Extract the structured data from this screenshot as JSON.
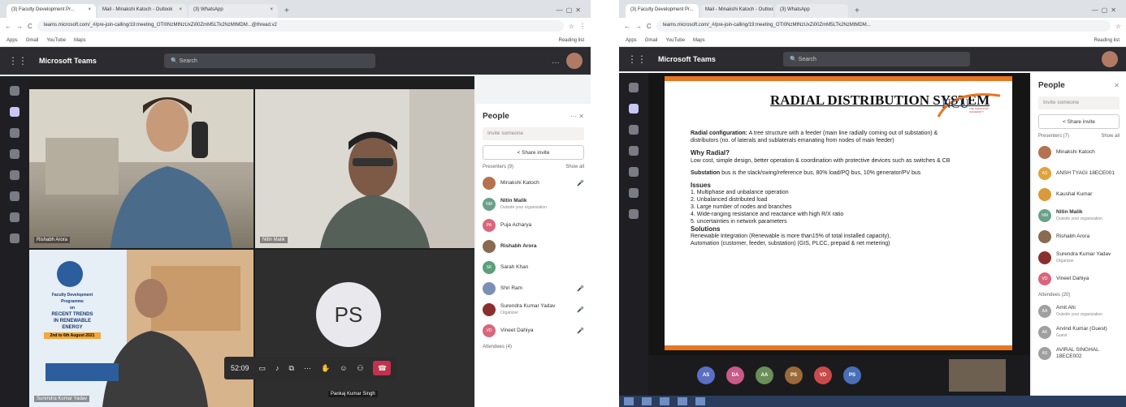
{
  "left": {
    "tabs": [
      "(3) Faculty Development Pr...",
      "Mail - Minakshi Katoch - Outlook",
      "(3) WhatsApp"
    ],
    "url": "teams.microsoft.com/_#/pre-join-calling/19:meeting_OTI0NzMtNzUxZi00ZmM5LTk2NzMtMDM...@thread.v2",
    "bookmarks": [
      "Apps",
      "Gmail",
      "YouTube",
      "Maps"
    ],
    "reading_list": "Reading list",
    "teams_title": "Microsoft Teams",
    "search_placeholder": "Search",
    "tiles": {
      "t1": "Rishabh Arora",
      "t2": "Nitin Malik",
      "t3": "Surendra Kumar Yadav",
      "ps_initials": "PS",
      "ps_name": "Pankaj Kumar Singh"
    },
    "poster": {
      "line1": "Faculty Development Programme",
      "line2": "on",
      "line3": "RECENT TRENDS",
      "line4": "IN RENEWABLE ENERGY",
      "line5": "2nd to 6th August 2021"
    },
    "controls": {
      "time": "52:09"
    },
    "people": {
      "title": "People",
      "invite": "Invite someone",
      "share": "Share invite",
      "presenters": "Presenters (9)",
      "show_all": "Show all",
      "list": [
        {
          "name": "Minakshi Katoch",
          "sub": ""
        },
        {
          "name": "Nitin Malik",
          "sub": "Outside your organization",
          "initials": "NM"
        },
        {
          "name": "Puja Acharya",
          "sub": "",
          "initials": "PA"
        },
        {
          "name": "Rishabh Arora",
          "sub": ""
        },
        {
          "name": "Sarah Khan",
          "sub": "",
          "initials": "SK"
        },
        {
          "name": "Shri Ram",
          "sub": ""
        },
        {
          "name": "Surendra Kumar Yadav",
          "sub": "Organizer"
        },
        {
          "name": "Vineet Dahiya",
          "sub": "",
          "initials": "VD"
        }
      ],
      "attendees": "Attendees (4)"
    }
  },
  "right": {
    "tabs": [
      "(3) Faculty Development Pr...",
      "Mail - Minakshi Katoch - Outlook",
      "(3) WhatsApp"
    ],
    "url": "teams.microsoft.com/_#/pre-join-calling/19:meeting_OTI0NzMtNzUxZi00ZmM5LTk2NzMtMDM...",
    "bookmarks": [
      "Apps",
      "Gmail",
      "YouTube",
      "Maps"
    ],
    "reading_list": "Reading list",
    "teams_title": "Microsoft Teams",
    "search_placeholder": "Search",
    "slide": {
      "title": "RADIAL DISTRIBUTION SYSTEM",
      "logo": "NCU",
      "logo_sub": "THE NORTHCAP UNIVERSITY",
      "radial_label": "Radial configuration:",
      "radial_text": "A tree structure with a feeder (main line radially coming out of substation) & distributors (no. of laterals and sublaterals emanating from nodes of main feeder)",
      "why_title": "Why Radial?",
      "why_text": "Low cost, simple design, better operation & coordination with protective devices such as switches & CB",
      "sub_label": "Substation",
      "sub_text": "bus is the slack/swing/reference bus, 80% load/PQ bus, 10% generator/PV bus",
      "issues_title": "Issues",
      "issues": [
        "1.  Multiphase and unbalance operation",
        "2.  Unbalanced distributed load",
        "3.  Large number of nodes and branches",
        "4.  Wide-ranging resistance and reactance with high R/X ratio",
        "5.  uncertainties in network parameters"
      ],
      "solutions_title": "Solutions",
      "solutions": [
        "Renewable Integration (Renewable is more than15% of total installed capacity),",
        "Automation (customer, feeder, substation) (GIS, PLCC, prepaid & net metering)"
      ]
    },
    "strip_avatars": [
      "AS",
      "DA",
      "AA",
      "PS",
      "VD",
      "PS"
    ],
    "people": {
      "title": "People",
      "invite": "Invite someone",
      "share": "Share invite",
      "presenters": "Presenters (7)",
      "show_all": "Show all",
      "list": [
        {
          "name": "Minakshi Katoch",
          "sub": ""
        },
        {
          "name": "ANSH TYAGI 18ECE001",
          "sub": "",
          "initials": "AS"
        },
        {
          "name": "Kaushal Kumar",
          "sub": ""
        },
        {
          "name": "Nitin Malik",
          "sub": "Outside your organization",
          "initials": "NM"
        },
        {
          "name": "Rishabh Arora",
          "sub": ""
        },
        {
          "name": "Surendra Kumar Yadav",
          "sub": "Organizer"
        },
        {
          "name": "Vineet Dahiya",
          "sub": "",
          "initials": "VD"
        }
      ],
      "attendees": "Attendees (20)",
      "att_list": [
        {
          "name": "Amit Ahi",
          "sub": "Outside your organization",
          "initials": "AA"
        },
        {
          "name": "Arvind Kumar (Guest)",
          "sub": "Guest",
          "initials": "AK"
        },
        {
          "name": "AVIRAL SINGHAL 18ECE002",
          "sub": "",
          "initials": "AS"
        }
      ]
    }
  },
  "colors": {
    "teams_dark": "#2b2b30",
    "hangup": "#c4314b",
    "slide_bar": "#e87722"
  }
}
